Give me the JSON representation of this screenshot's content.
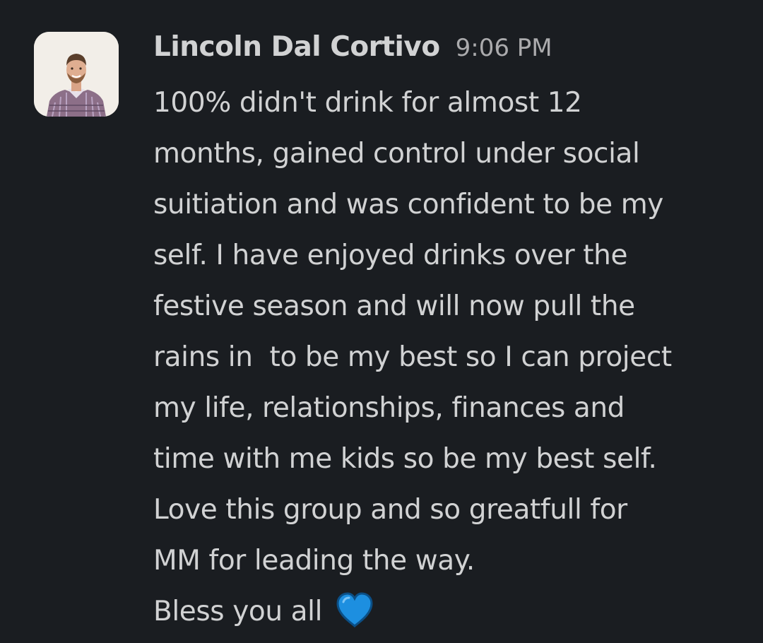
{
  "message": {
    "sender": "Lincoln Dal Cortivo",
    "timestamp": "9:06 PM",
    "lines": [
      "100% didn't drink for almost 12",
      "months, gained control under social",
      "suitiation and was confident to be my",
      "self. I have enjoyed drinks over the",
      "festive season and will now pull the",
      "rains in  to be my best so I can project",
      "my life, relationships, finances and",
      "time with me kids so be my best self.",
      "Love this group and so greatfull for",
      "MM for leading the way.",
      "Bless you all "
    ],
    "emoji": "blue-heart-emoji"
  },
  "colors": {
    "background": "#1a1d21",
    "text": "#d1d2d3",
    "timestamp": "#ababad",
    "heart": "#1d8fe0"
  }
}
